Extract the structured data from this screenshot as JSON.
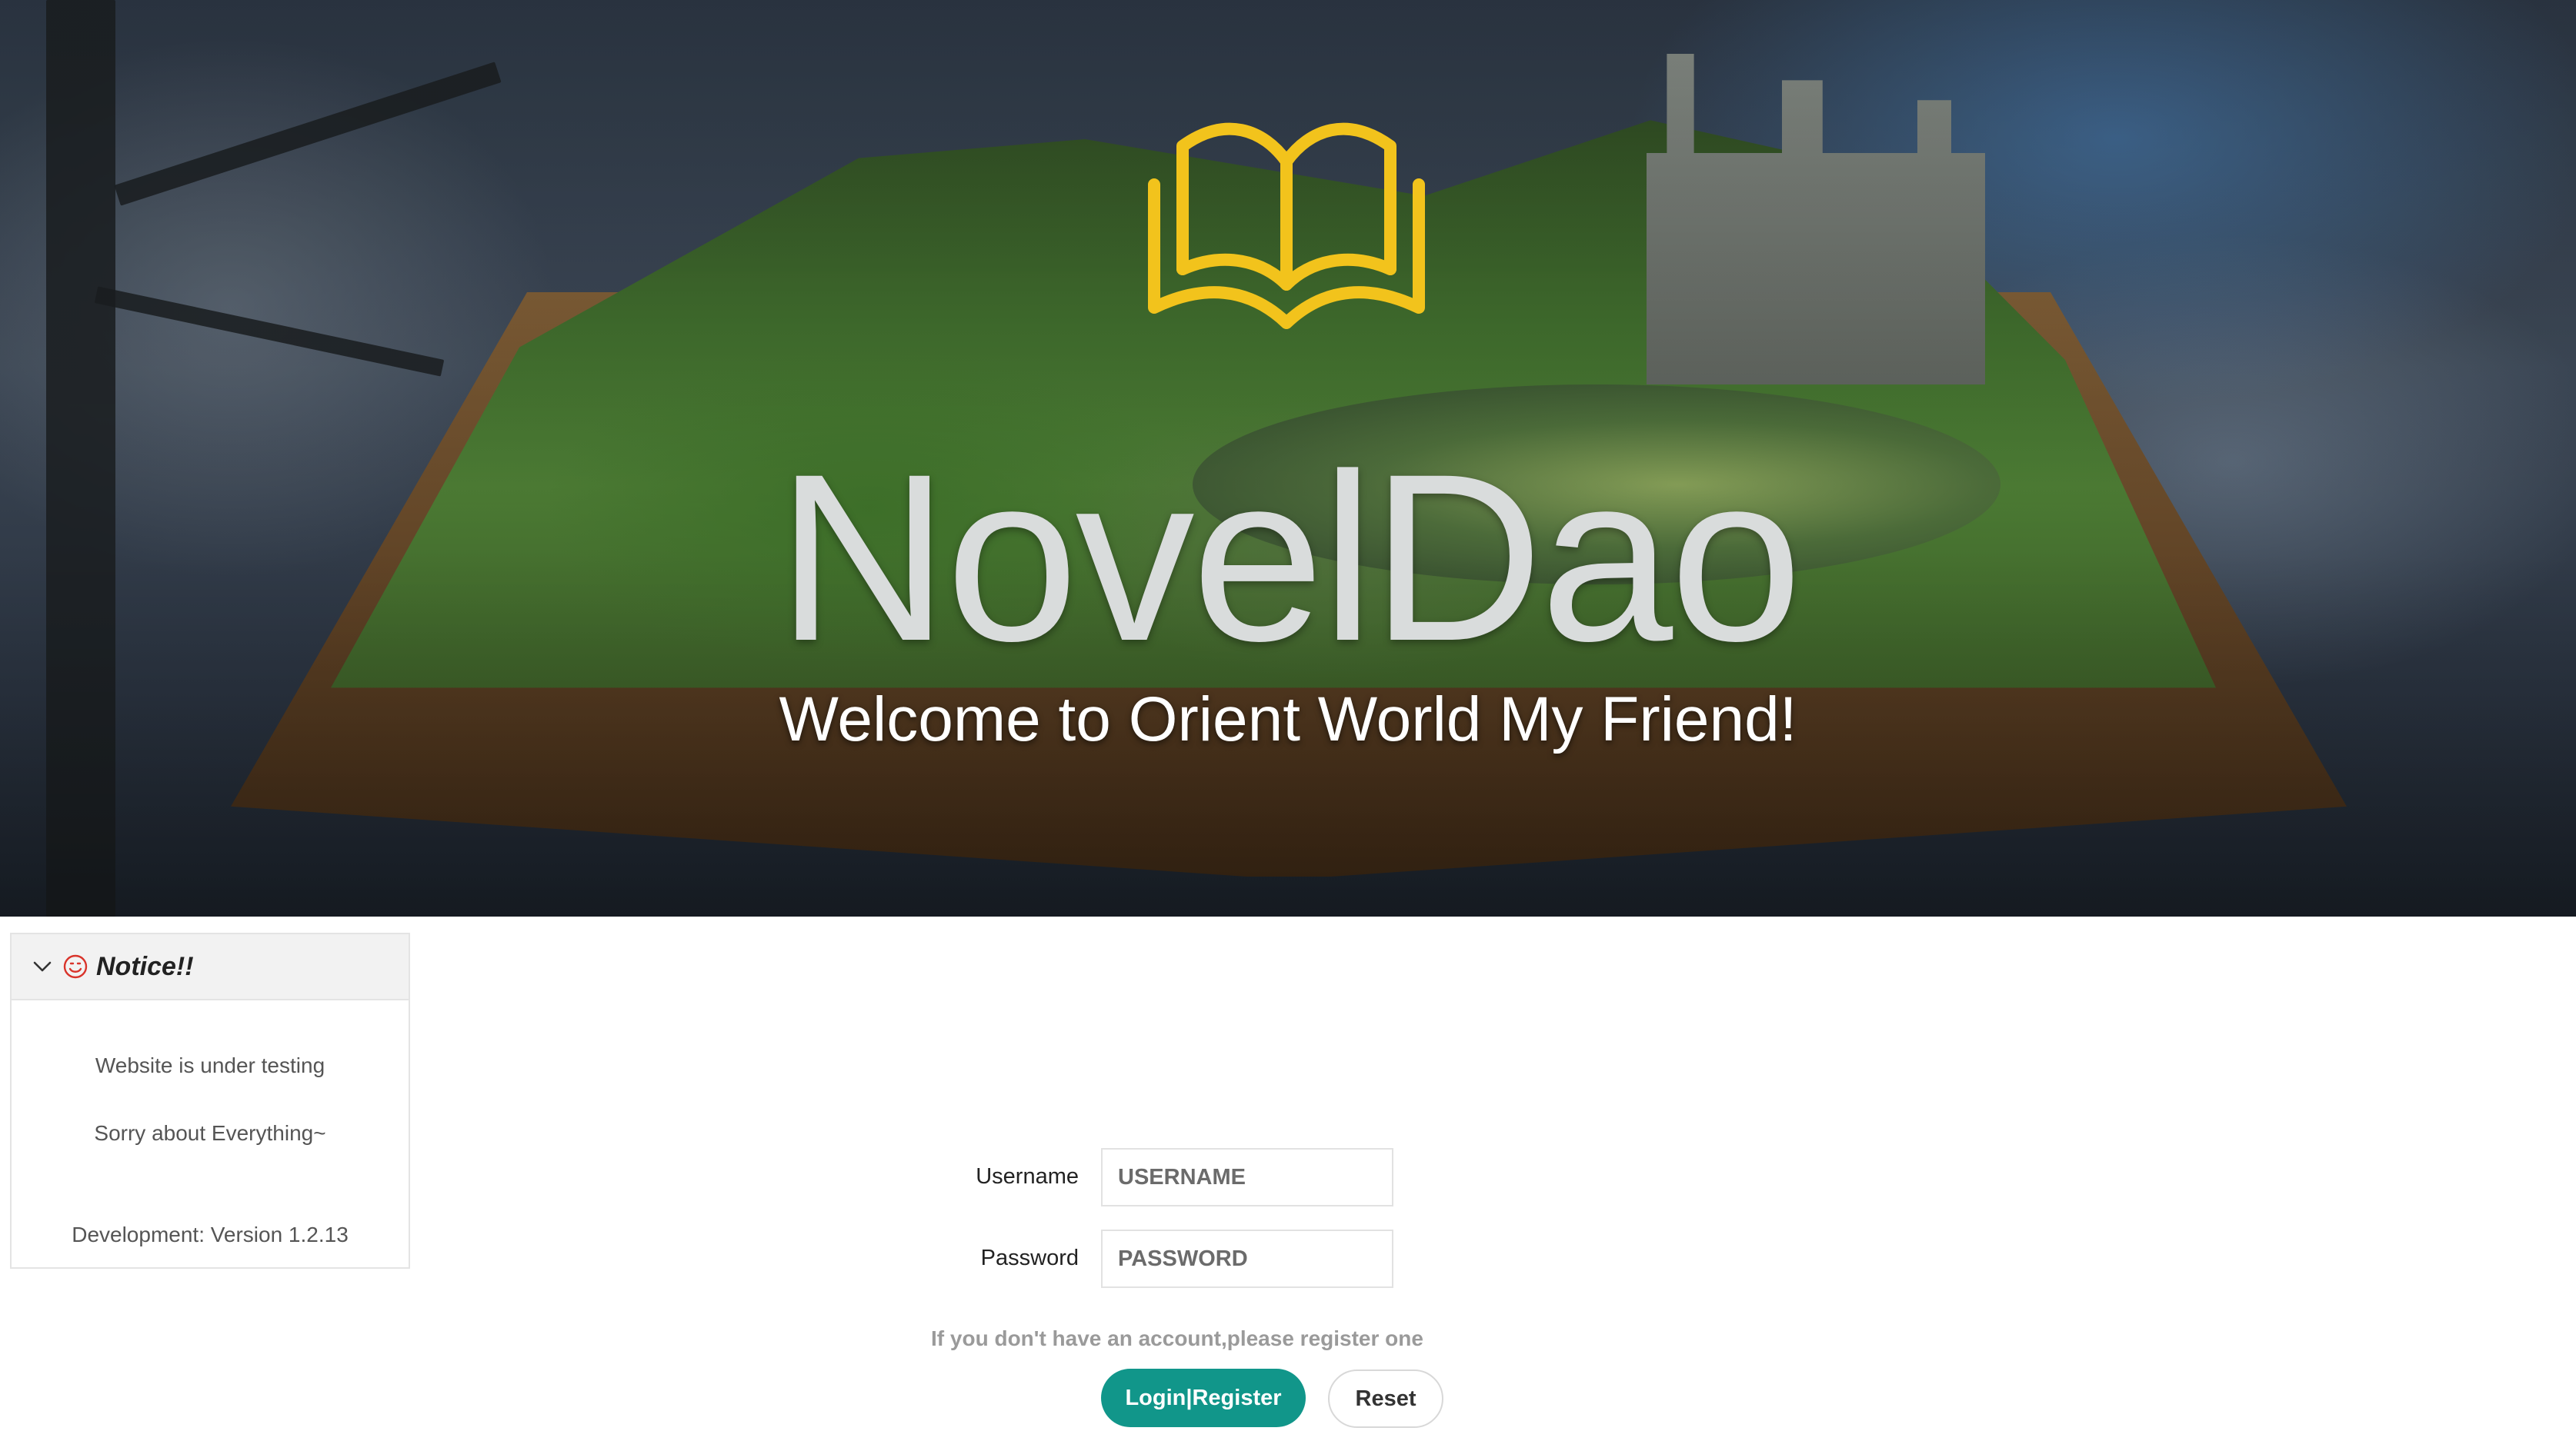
{
  "hero": {
    "title": "NovelDao",
    "subtitle": "Welcome to Orient World My Friend!",
    "logo_icon": "open-book-icon",
    "logo_color": "#f2c31c"
  },
  "notice": {
    "title": "Notice!!",
    "collapse_icon": "chevron-down-icon",
    "emoji_icon": "smile-icon",
    "emoji_color": "#d9342b",
    "lines": [
      "Website is under testing",
      "Sorry about Everything~"
    ],
    "version": "Development: Version 1.2.13"
  },
  "login": {
    "username_label": "Username",
    "username_placeholder": "USERNAME",
    "username_value": "",
    "password_label": "Password",
    "password_placeholder": "PASSWORD",
    "password_value": "",
    "hint": "If you don't have an account,please register one",
    "submit_label": "Login|Register",
    "reset_label": "Reset",
    "accent_color": "#11968a"
  }
}
